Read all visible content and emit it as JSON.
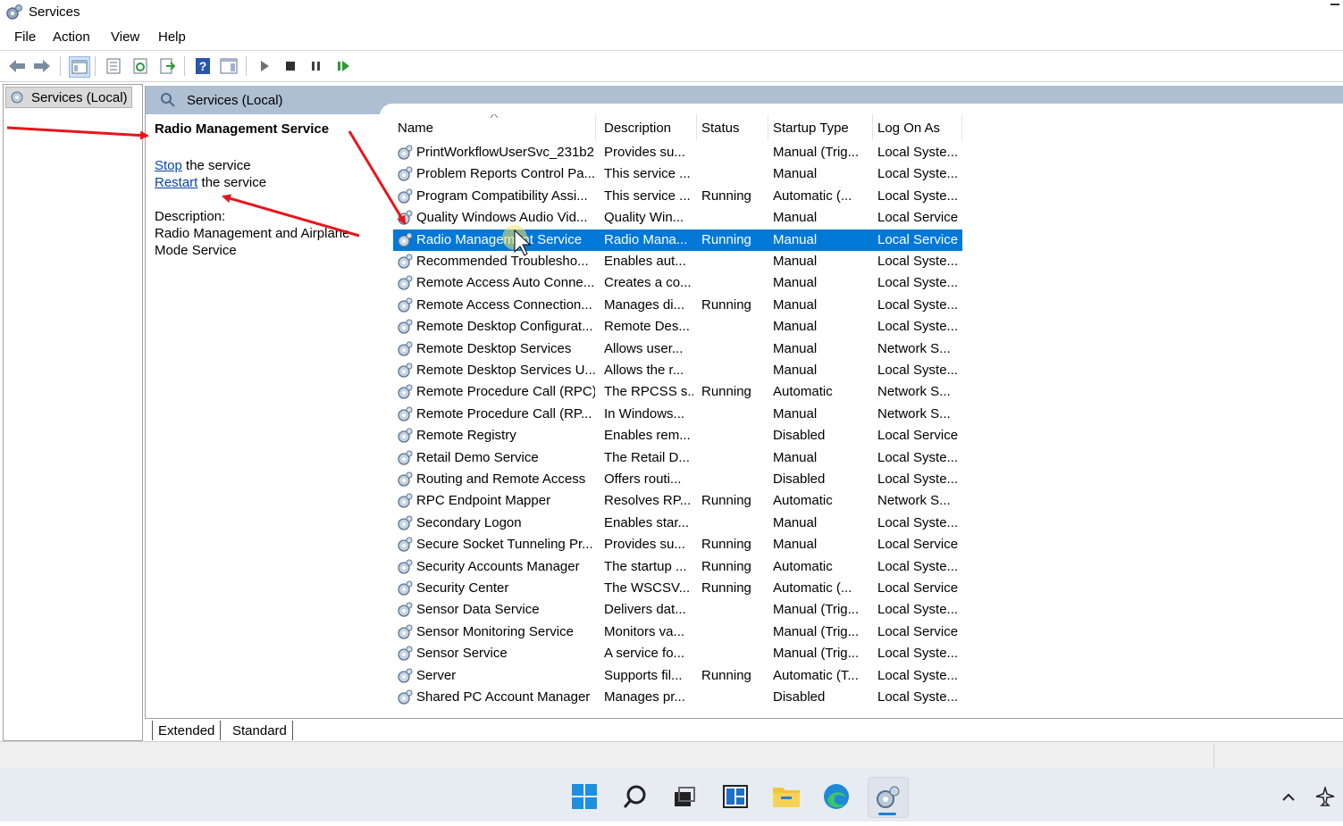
{
  "window": {
    "title": "Services",
    "icon": "services-gear-icon"
  },
  "menu": [
    "File",
    "Action",
    "View",
    "Help"
  ],
  "toolbar": {
    "icons": [
      "back-arrow-icon",
      "forward-arrow-icon",
      "show-hide-console-tree-icon",
      "properties-icon",
      "refresh-icon",
      "export-list-icon",
      "help-icon",
      "show-hide-action-pane-icon",
      "start-service-icon",
      "stop-service-icon",
      "pause-service-icon",
      "resume-service-icon"
    ]
  },
  "tree": {
    "root_label": "Services (Local)"
  },
  "panel": {
    "header": "Services (Local)",
    "selected_service": "Radio Management Service",
    "stop_link": "Stop",
    "stop_suffix": " the service",
    "restart_link": "Restart",
    "restart_suffix": " the service",
    "description_label": "Description:",
    "description_text": "Radio Management and Airplane Mode Service"
  },
  "columns": [
    "Name",
    "Description",
    "Status",
    "Startup Type",
    "Log On As"
  ],
  "services": [
    {
      "name": "PrintWorkflowUserSvc_231b2",
      "desc": "Provides su...",
      "status": "",
      "startup": "Manual (Trig...",
      "logon": "Local Syste..."
    },
    {
      "name": "Problem Reports Control Pa...",
      "desc": "This service ...",
      "status": "",
      "startup": "Manual",
      "logon": "Local Syste..."
    },
    {
      "name": "Program Compatibility Assi...",
      "desc": "This service ...",
      "status": "Running",
      "startup": "Automatic (...",
      "logon": "Local Syste..."
    },
    {
      "name": "Quality Windows Audio Vid...",
      "desc": "Quality Win...",
      "status": "",
      "startup": "Manual",
      "logon": "Local Service"
    },
    {
      "name": "Radio Management Service",
      "desc": "Radio Mana...",
      "status": "Running",
      "startup": "Manual",
      "logon": "Local Service",
      "selected": true
    },
    {
      "name": "Recommended Troublesho...",
      "desc": "Enables aut...",
      "status": "",
      "startup": "Manual",
      "logon": "Local Syste..."
    },
    {
      "name": "Remote Access Auto Conne...",
      "desc": "Creates a co...",
      "status": "",
      "startup": "Manual",
      "logon": "Local Syste..."
    },
    {
      "name": "Remote Access Connection...",
      "desc": "Manages di...",
      "status": "Running",
      "startup": "Manual",
      "logon": "Local Syste..."
    },
    {
      "name": "Remote Desktop Configurat...",
      "desc": "Remote Des...",
      "status": "",
      "startup": "Manual",
      "logon": "Local Syste..."
    },
    {
      "name": "Remote Desktop Services",
      "desc": "Allows user...",
      "status": "",
      "startup": "Manual",
      "logon": "Network S..."
    },
    {
      "name": "Remote Desktop Services U...",
      "desc": "Allows the r...",
      "status": "",
      "startup": "Manual",
      "logon": "Local Syste..."
    },
    {
      "name": "Remote Procedure Call (RPC)",
      "desc": "The RPCSS s...",
      "status": "Running",
      "startup": "Automatic",
      "logon": "Network S..."
    },
    {
      "name": "Remote Procedure Call (RP...",
      "desc": "In Windows...",
      "status": "",
      "startup": "Manual",
      "logon": "Network S..."
    },
    {
      "name": "Remote Registry",
      "desc": "Enables rem...",
      "status": "",
      "startup": "Disabled",
      "logon": "Local Service"
    },
    {
      "name": "Retail Demo Service",
      "desc": "The Retail D...",
      "status": "",
      "startup": "Manual",
      "logon": "Local Syste..."
    },
    {
      "name": "Routing and Remote Access",
      "desc": "Offers routi...",
      "status": "",
      "startup": "Disabled",
      "logon": "Local Syste..."
    },
    {
      "name": "RPC Endpoint Mapper",
      "desc": "Resolves RP...",
      "status": "Running",
      "startup": "Automatic",
      "logon": "Network S..."
    },
    {
      "name": "Secondary Logon",
      "desc": "Enables star...",
      "status": "",
      "startup": "Manual",
      "logon": "Local Syste..."
    },
    {
      "name": "Secure Socket Tunneling Pr...",
      "desc": "Provides su...",
      "status": "Running",
      "startup": "Manual",
      "logon": "Local Service"
    },
    {
      "name": "Security Accounts Manager",
      "desc": "The startup ...",
      "status": "Running",
      "startup": "Automatic",
      "logon": "Local Syste..."
    },
    {
      "name": "Security Center",
      "desc": "The WSCSV...",
      "status": "Running",
      "startup": "Automatic (...",
      "logon": "Local Service"
    },
    {
      "name": "Sensor Data Service",
      "desc": "Delivers dat...",
      "status": "",
      "startup": "Manual (Trig...",
      "logon": "Local Syste..."
    },
    {
      "name": "Sensor Monitoring Service",
      "desc": "Monitors va...",
      "status": "",
      "startup": "Manual (Trig...",
      "logon": "Local Service"
    },
    {
      "name": "Sensor Service",
      "desc": "A service fo...",
      "status": "",
      "startup": "Manual (Trig...",
      "logon": "Local Syste..."
    },
    {
      "name": "Server",
      "desc": "Supports fil...",
      "status": "Running",
      "startup": "Automatic (T...",
      "logon": "Local Syste..."
    },
    {
      "name": "Shared PC Account Manager",
      "desc": "Manages pr...",
      "status": "",
      "startup": "Disabled",
      "logon": "Local Syste..."
    }
  ],
  "tabs": [
    "Extended",
    "Standard"
  ],
  "taskbar": {
    "icons": [
      "windows-start-icon",
      "search-icon",
      "task-view-icon",
      "widgets-icon",
      "file-explorer-icon",
      "edge-browser-icon",
      "services-app-icon"
    ],
    "tray": [
      "chevron-up-icon",
      "airplane-mode-icon"
    ]
  },
  "colors": {
    "selection": "#0078d7",
    "panel_header": "#aebfd3",
    "annotation_arrow": "#e8141b",
    "link": "#0645ad"
  }
}
